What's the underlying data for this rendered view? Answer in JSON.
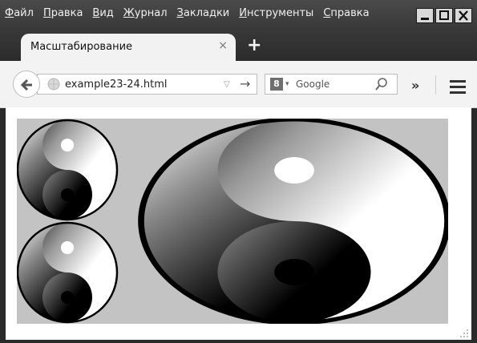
{
  "menubar": {
    "items": [
      {
        "prefix": "",
        "ul": "Ф",
        "rest": "айл"
      },
      {
        "prefix": "",
        "ul": "П",
        "rest": "равка"
      },
      {
        "prefix": "",
        "ul": "В",
        "rest": "ид"
      },
      {
        "prefix": "",
        "ul": "Ж",
        "rest": "урнал"
      },
      {
        "prefix": "",
        "ul": "З",
        "rest": "акладки"
      },
      {
        "prefix": "",
        "ul": "И",
        "rest": "нструменты"
      },
      {
        "prefix": "",
        "ul": "С",
        "rest": "правка"
      }
    ]
  },
  "tab": {
    "title": "Масштабирование",
    "close": "×"
  },
  "newtab": "+",
  "url": {
    "value": "example23-24.html"
  },
  "search": {
    "engine_badge": "8",
    "placeholder": "Google"
  },
  "toolbar": {
    "overflow": "»"
  },
  "icons": {
    "back": "back-arrow-icon",
    "globe": "globe-icon",
    "search": "magnifier-icon",
    "menu": "hamburger-menu-icon"
  },
  "colors": {
    "chrome": "#3b3b3b",
    "canvas_bg": "#c3c3c3"
  }
}
